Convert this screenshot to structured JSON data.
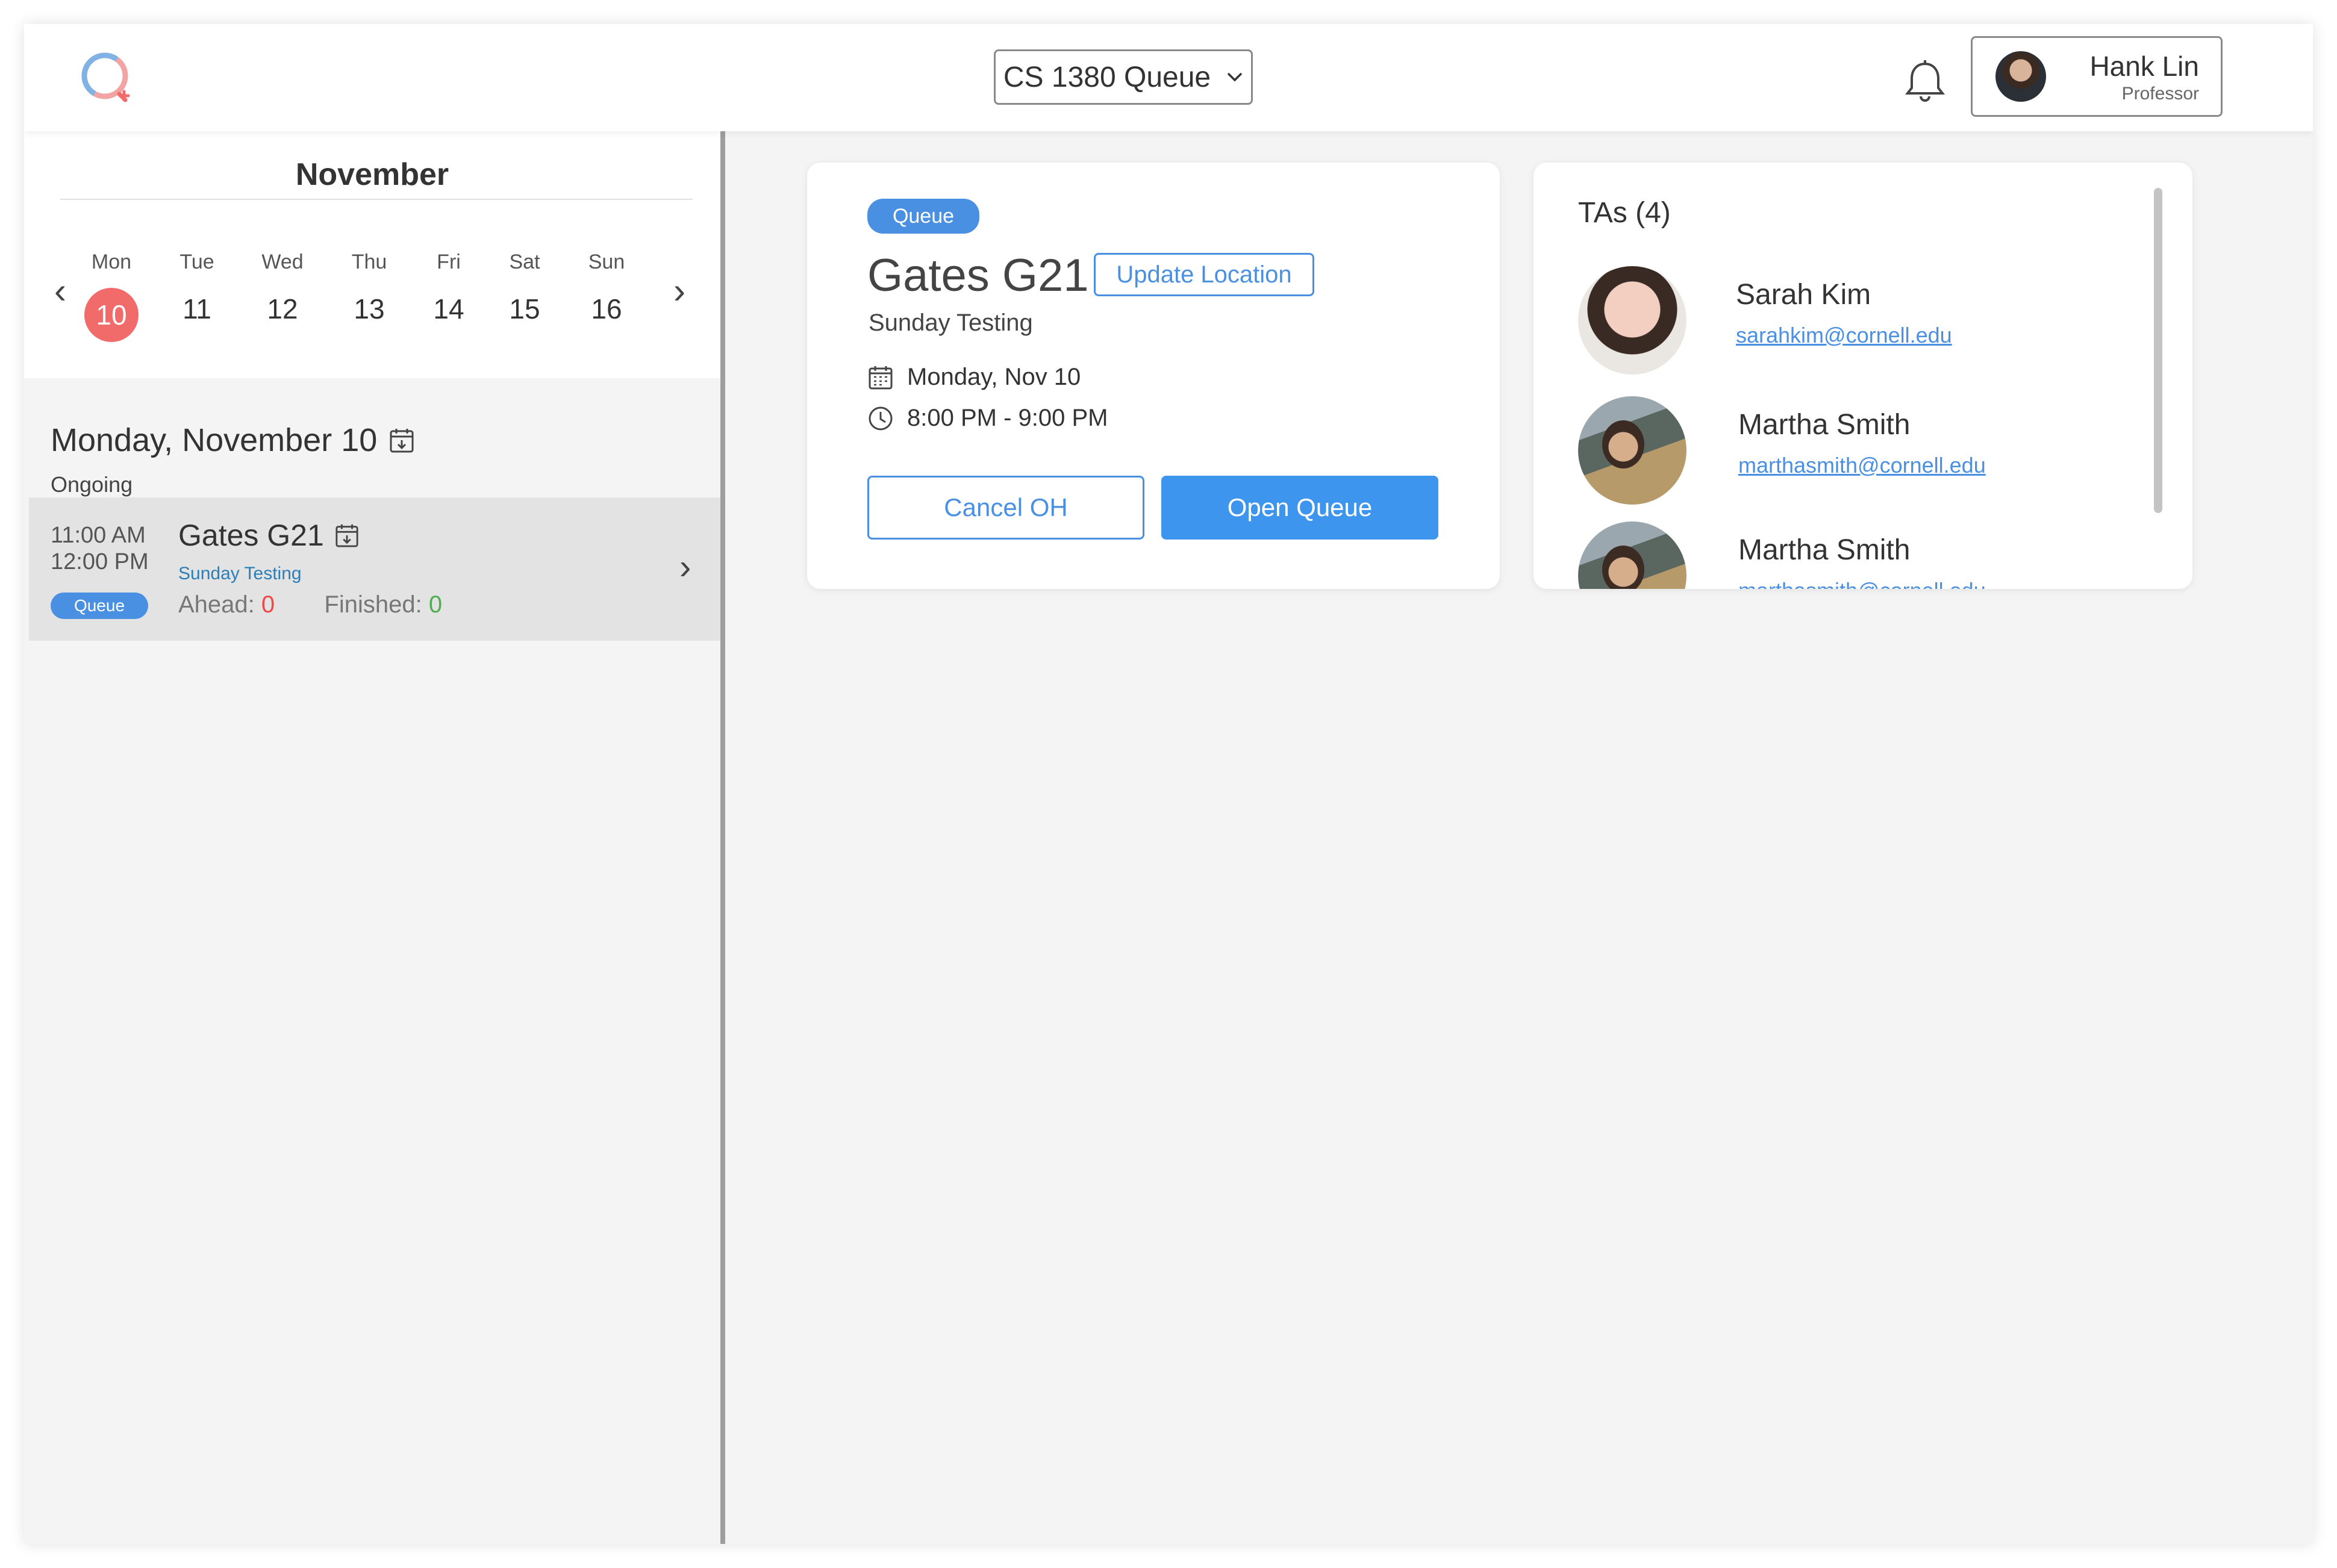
{
  "header": {
    "course_label": "CS 1380 Queue",
    "user_name": "Hank Lin",
    "user_role": "Professor"
  },
  "calendar": {
    "month": "November",
    "days": [
      {
        "name": "Mon",
        "date": "10",
        "selected": true
      },
      {
        "name": "Tue",
        "date": "11"
      },
      {
        "name": "Wed",
        "date": "12"
      },
      {
        "name": "Thu",
        "date": "13"
      },
      {
        "name": "Fri",
        "date": "14"
      },
      {
        "name": "Sat",
        "date": "15"
      },
      {
        "name": "Sun",
        "date": "16"
      }
    ],
    "prev_label": "‹",
    "next_label": "›"
  },
  "sidebar": {
    "date_heading": "Monday, November 10",
    "status": "Ongoing",
    "session": {
      "start_time": "11:00 AM",
      "end_time": "12:00 PM",
      "badge": "Queue",
      "title": "Gates G21",
      "subtitle": "Sunday Testing",
      "ahead_label": "Ahead:",
      "ahead_value": "0",
      "finished_label": "Finished:",
      "finished_value": "0"
    }
  },
  "office_hour": {
    "badge": "Queue",
    "title": "Gates G21",
    "update_location_label": "Update Location",
    "subtitle": "Sunday Testing",
    "date": "Monday, Nov 10",
    "time": "8:00 PM - 9:00 PM",
    "cancel_label": "Cancel OH",
    "open_label": "Open Queue"
  },
  "tas": {
    "title": "TAs (4)",
    "items": [
      {
        "name": "Sarah Kim",
        "email": "sarahkim@cornell.edu"
      },
      {
        "name": "Martha Smith",
        "email": "marthasmith@cornell.edu"
      },
      {
        "name": "Martha Smith",
        "email": "marthasmith@cornell.edu"
      }
    ]
  },
  "colors": {
    "accent": "#4a90e2",
    "primary_button": "#3d95ee",
    "selected_day": "#f26b6b",
    "ahead": "#f04848",
    "finished": "#4caf50"
  }
}
